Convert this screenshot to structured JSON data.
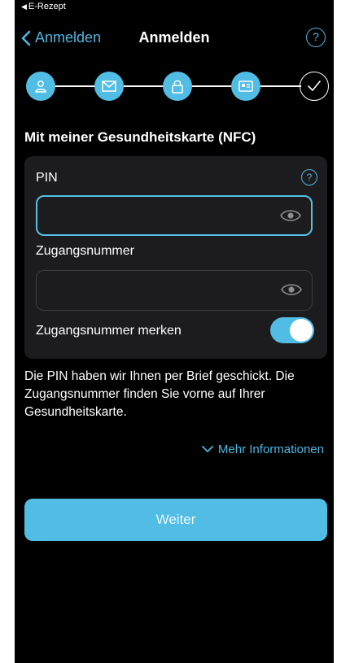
{
  "status_bar": {
    "back_app": "E-Rezept"
  },
  "nav": {
    "back_label": "Anmelden",
    "title": "Anmelden",
    "help": "?"
  },
  "stepper": {
    "steps": [
      "person-icon",
      "envelope-icon",
      "lock-icon",
      "id-card-icon",
      "checkmark-icon"
    ]
  },
  "section_title": "Mit meiner Gesundheitskarte (NFC)",
  "form": {
    "pin_label": "PIN",
    "pin_value": "",
    "pin_help": "?",
    "access_label": "Zugangsnummer",
    "access_value": "",
    "remember_label": "Zugangsnummer merken",
    "remember_on": true
  },
  "info": {
    "text": "Die PIN haben wir Ihnen per Brief geschickt. Die Zugangsnummer finden Sie vorne auf Ihrer Gesundheitskarte.",
    "more_link": "Mehr Informationen"
  },
  "primary_button": "Weiter",
  "colors": {
    "accent": "#51bde5",
    "background": "#000000",
    "card": "#1c1c1e"
  }
}
